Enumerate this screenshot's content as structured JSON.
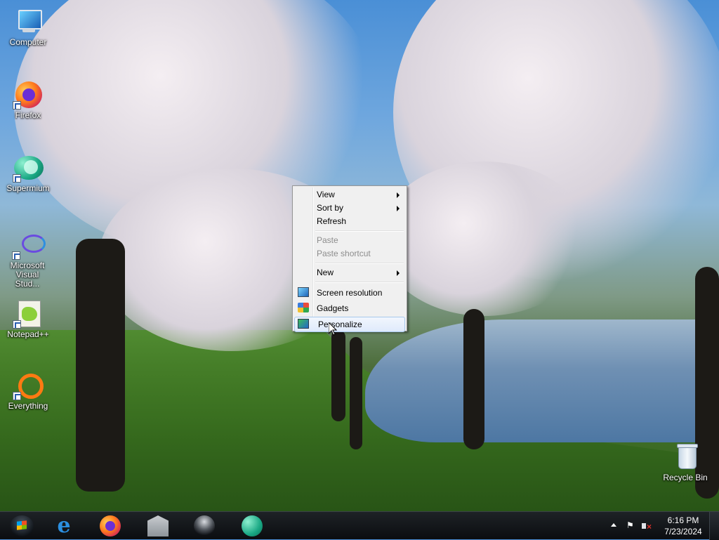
{
  "desktop": {
    "icons": [
      {
        "label": "Computer",
        "icon": "computer-icon"
      },
      {
        "label": "Firefox",
        "icon": "firefox-icon"
      },
      {
        "label": "Supermium",
        "icon": "supermium-icon"
      },
      {
        "label": "Microsoft Visual Stud...",
        "icon": "visual-studio-icon"
      },
      {
        "label": "Notepad++",
        "icon": "notepad-plus-plus-icon"
      },
      {
        "label": "Everything",
        "icon": "everything-icon"
      },
      {
        "label": "Recycle Bin",
        "icon": "recycle-bin-icon"
      }
    ]
  },
  "context_menu": {
    "items": [
      {
        "label": "View",
        "submenu": true,
        "enabled": true
      },
      {
        "label": "Sort by",
        "submenu": true,
        "enabled": true
      },
      {
        "label": "Refresh",
        "enabled": true
      },
      {
        "label": "Paste",
        "enabled": false
      },
      {
        "label": "Paste shortcut",
        "enabled": false
      },
      {
        "label": "New",
        "submenu": true,
        "enabled": true
      },
      {
        "label": "Screen resolution",
        "icon": "screen-resolution-icon",
        "enabled": true
      },
      {
        "label": "Gadgets",
        "icon": "gadgets-icon",
        "enabled": true
      },
      {
        "label": "Personalize",
        "icon": "personalize-icon",
        "enabled": true,
        "highlighted": true
      }
    ]
  },
  "taskbar": {
    "start": "windows-logo-icon",
    "pinned": [
      "internet-explorer-icon",
      "firefox-icon",
      "library-icon",
      "media-disc-icon",
      "supermium-icon"
    ],
    "ie_glyph": "e",
    "tray": {
      "flag_glyph": "⚑",
      "time": "6:16 PM",
      "date": "7/23/2024"
    }
  }
}
